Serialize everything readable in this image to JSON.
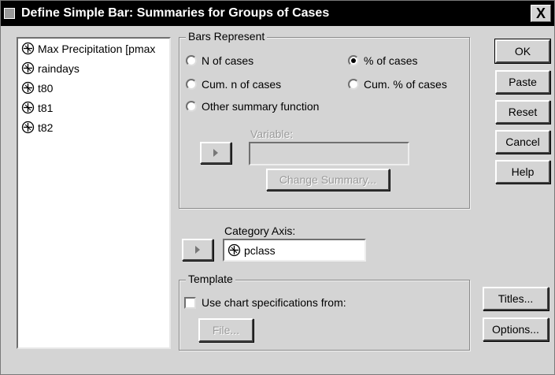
{
  "window": {
    "title": "Define Simple Bar: Summaries for Groups of Cases",
    "close_glyph": "X"
  },
  "variables": [
    {
      "label": "Max Precipitation [pmax",
      "icon": "scale-variable-icon"
    },
    {
      "label": "raindays",
      "icon": "scale-variable-icon"
    },
    {
      "label": "t80",
      "icon": "scale-variable-icon"
    },
    {
      "label": "t81",
      "icon": "scale-variable-icon"
    },
    {
      "label": "t82",
      "icon": "scale-variable-icon"
    }
  ],
  "bars_represent": {
    "legend": "Bars Represent",
    "options": {
      "n_cases": "N of cases",
      "pct_cases": "% of cases",
      "cum_n": "Cum. n of cases",
      "cum_pct": "Cum. % of cases",
      "other": "Other summary function"
    },
    "selected": "% of cases",
    "variable_label": "Variable:",
    "variable_value": "",
    "change_summary_label": "Change Summary..."
  },
  "category_axis": {
    "label": "Category Axis:",
    "value": "pclass",
    "icon": "scale-variable-icon"
  },
  "template": {
    "legend": "Template",
    "checkbox_label": "Use chart specifications from:",
    "checked": false,
    "file_button_label": "File..."
  },
  "buttons": {
    "ok": "OK",
    "paste": "Paste",
    "reset": "Reset",
    "cancel": "Cancel",
    "help": "Help",
    "titles": "Titles...",
    "options": "Options..."
  }
}
